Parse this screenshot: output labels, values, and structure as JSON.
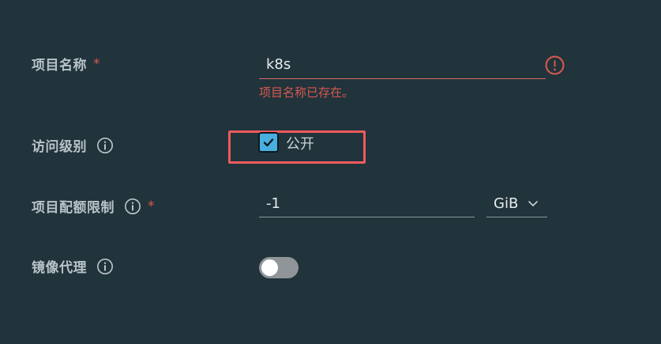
{
  "form": {
    "project_name": {
      "label": "项目名称",
      "required_mark": "*",
      "value": "k8s",
      "error_message": "项目名称已存在。",
      "error_icon": "exclamation-circle-icon"
    },
    "access_level": {
      "label": "访问级别",
      "info_icon": "info-circle-icon",
      "checkbox_label": "公开",
      "checked": true
    },
    "quota_limit": {
      "label": "项目配额限制",
      "info_icon": "info-circle-icon",
      "required_mark": "*",
      "value": "-1",
      "unit_selected": "GiB"
    },
    "proxy_cache": {
      "label": "镜像代理",
      "info_icon": "info-circle-icon",
      "enabled": false
    }
  },
  "colors": {
    "background": "#21333b",
    "error": "#d6594f",
    "checkbox_checked": "#49aee0",
    "highlight_box": "#ef5a5d",
    "toggle_off": "#8f9598"
  }
}
